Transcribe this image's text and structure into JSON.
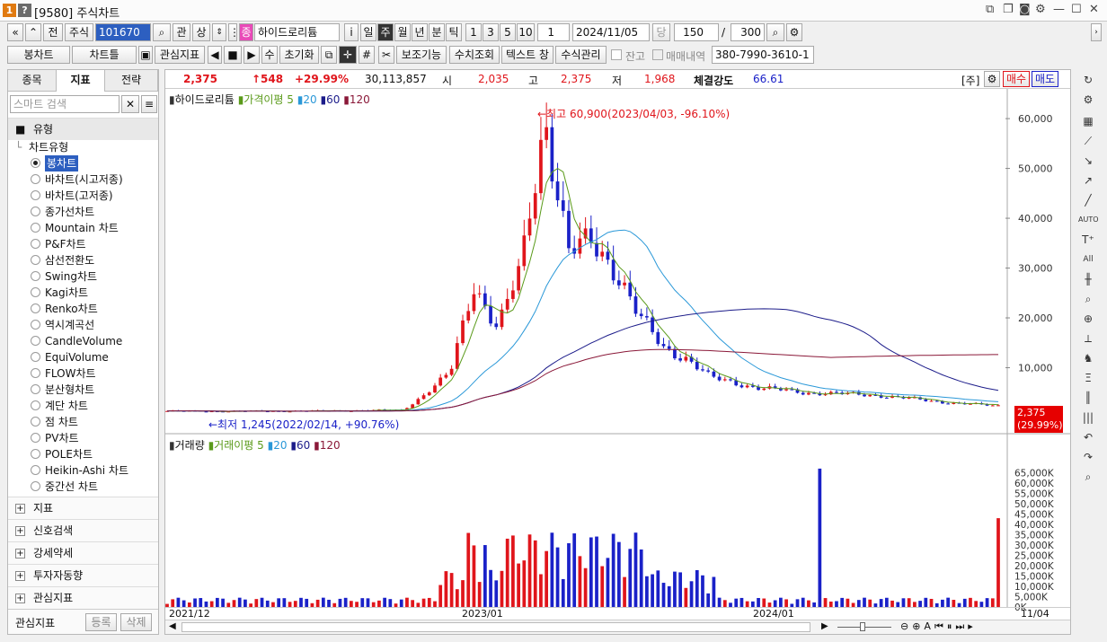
{
  "window": {
    "title_id": "[9580]",
    "title": "주식차트",
    "badge1": "1",
    "badge2": "?"
  },
  "toolbar1": {
    "nav_first": "«",
    "nav_up": "«",
    "prev": "전",
    "market": "주식",
    "code": "101670",
    "search": "⌕",
    "favorite": "관",
    "up": "상",
    "name_flag": "종",
    "stock_name": "하이드로리튬",
    "info": "i",
    "period_day": "일",
    "period_week": "주",
    "period_month": "월",
    "period_year": "년",
    "period_min": "분",
    "period_tick": "틱",
    "num1": "1",
    "num3": "3",
    "num5": "5",
    "num10": "10",
    "interval": "1",
    "date": "2024/11/05",
    "current": "당",
    "count": "150",
    "slash": "/",
    "total": "300"
  },
  "toolbar2": {
    "chart_type": "봉차트",
    "chart_tool": "차트틀",
    "interest": "관심지표",
    "manual": "수",
    "reset": "초기화",
    "aux": "보조기능",
    "numeric": "수치조회",
    "text_window": "텍스트 창",
    "formula": "수식관리",
    "balance": "잔고",
    "trade_history": "매매내역",
    "account": "380-7990-3610-1"
  },
  "left_panel": {
    "tabs": [
      "종목",
      "지표",
      "전략"
    ],
    "search_placeholder": "스마트 검색",
    "section_type": "유형",
    "subsection": "차트유형",
    "chart_types": [
      "봉차트",
      "바차트(시고저종)",
      "바차트(고저종)",
      "종가선차트",
      "Mountain 차트",
      "P&F차트",
      "삼선전환도",
      "Swing차트",
      "Kagi차트",
      "Renko차트",
      "역시계곡선",
      "CandleVolume",
      "EquiVolume",
      "FLOW차트",
      "분산형차트",
      "계단 차트",
      "점 차트",
      "PV차트",
      "POLE차트",
      "Heikin-Ashi 차트",
      "중간선 차트"
    ],
    "sections": [
      "지표",
      "신호검색",
      "강세약세",
      "투자자동향",
      "관심지표"
    ],
    "footer": {
      "label": "관심지표",
      "register": "등록",
      "delete": "삭제"
    }
  },
  "quote": {
    "price": "2,375",
    "change": "↑548",
    "change_pct": "+29.99%",
    "volume": "30,113,857",
    "open_label": "시",
    "open": "2,035",
    "high_label": "고",
    "high": "2,375",
    "low_label": "저",
    "low": "1,968",
    "strength_label": "체결강도",
    "strength": "66.61",
    "unit": "[주]",
    "buy": "매수",
    "sell": "매도"
  },
  "price_pane": {
    "legend": {
      "name": "하이드로리튬",
      "ma_label": "가격이평",
      "ma5": "5",
      "ma20": "20",
      "ma60": "60",
      "ma120": "120"
    },
    "y_ticks": [
      "60,000",
      "50,000",
      "40,000",
      "30,000",
      "20,000",
      "10,000"
    ],
    "high_annotation": "←최고 60,900(2023/04/03, -96.10%)",
    "low_annotation": "←최저 1,245(2022/02/14, +90.76%)",
    "last_price": "2,375",
    "last_pct": "(29.99%)"
  },
  "volume_pane": {
    "legend": {
      "name": "거래량",
      "ma_label": "거래이평",
      "ma5": "5",
      "ma20": "20",
      "ma60": "60",
      "ma120": "120"
    },
    "y_ticks": [
      "65,000K",
      "60,000K",
      "55,000K",
      "50,000K",
      "45,000K",
      "40,000K",
      "35,000K",
      "30,000K",
      "25,000K",
      "20,000K",
      "15,000K",
      "10,000K",
      "5,000K",
      "0K"
    ]
  },
  "x_axis": {
    "labels": [
      "2021/12",
      "2023/01",
      "2024/01",
      "11/04"
    ]
  },
  "colors": {
    "up": "#e0151b",
    "down": "#1a21c8",
    "ma5": "#5a9a1a",
    "ma20": "#2a98d8",
    "ma60": "#1c1c8a",
    "ma120": "#8a1838",
    "accent": "#ff0000"
  },
  "chart_data": {
    "type": "candlestick",
    "x_range": [
      "2021/12",
      "2024/11"
    ],
    "y_range": [
      0,
      62000
    ],
    "periods": "weekly",
    "price_points_approx": [
      [
        "2021/12",
        1300
      ],
      [
        "2022/02",
        1245
      ],
      [
        "2022/06",
        1300
      ],
      [
        "2022/10",
        1500
      ],
      [
        "2022/11",
        5000
      ],
      [
        "2022/12",
        9000
      ],
      [
        "2023/01",
        27000
      ],
      [
        "2023/02",
        18000
      ],
      [
        "2023/03",
        30000
      ],
      [
        "2023/04",
        60900
      ],
      [
        "2023/05",
        33000
      ],
      [
        "2023/06",
        35000
      ],
      [
        "2023/07",
        30000
      ],
      [
        "2023/08",
        20000
      ],
      [
        "2023/09",
        14000
      ],
      [
        "2023/10",
        12000
      ],
      [
        "2023/11",
        8000
      ],
      [
        "2023/12",
        7000
      ],
      [
        "2024/01",
        6000
      ],
      [
        "2024/03",
        5000
      ],
      [
        "2024/06",
        4500
      ],
      [
        "2024/09",
        3000
      ],
      [
        "2024/11",
        2375
      ]
    ],
    "ma120_end": 14500,
    "ma60_end": 6000,
    "volume_peak": "67,000K",
    "volume_last": "30,113,857"
  }
}
